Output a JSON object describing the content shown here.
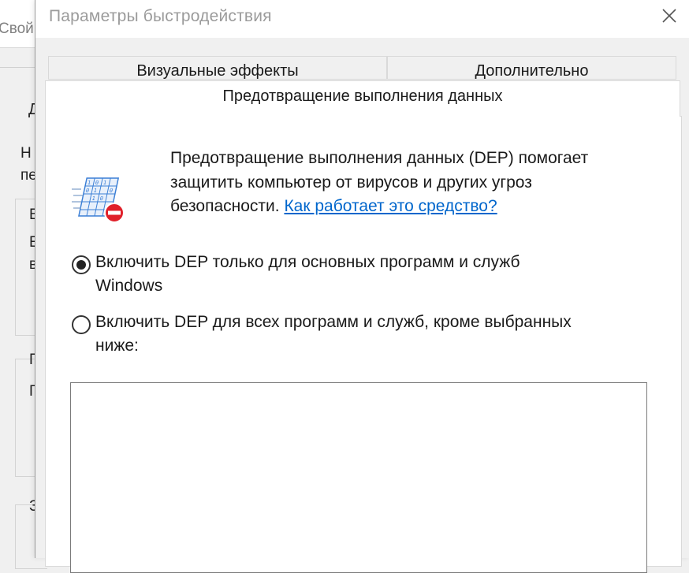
{
  "background_window": {
    "title_fragment": "Свой",
    "tab_fragment": "Д",
    "line1_fragment": "Н",
    "line2_fragment": "пе",
    "glyphs": [
      "В",
      "Е",
      "в",
      "П",
      "Г",
      "З"
    ]
  },
  "dialog": {
    "title": "Параметры быстродействия",
    "tabs": [
      {
        "label": "Визуальные эффекты"
      },
      {
        "label": "Дополнительно"
      },
      {
        "label": "Предотвращение выполнения данных"
      }
    ],
    "active_tab_index": 2,
    "description": {
      "line1": "Предотвращение выполнения данных (DEP) помогает",
      "line2": "защитить компьютер от вирусов и других угроз",
      "line3_prefix": "безопасности. ",
      "link": "Как работает это средство?"
    },
    "options": [
      {
        "line1": "Включить DEP только для основных программ и служб",
        "line2": "Windows",
        "selected": true
      },
      {
        "line1": "Включить DEP для всех программ и служб, кроме выбранных",
        "line2": "ниже:",
        "selected": false
      }
    ],
    "program_list": []
  },
  "icons": {
    "close": "close-icon",
    "dep": "dep-shield-icon"
  },
  "colors": {
    "link": "#0066cc",
    "icon_badge": "#e0202a",
    "icon_grid": "#3b7fd6"
  }
}
